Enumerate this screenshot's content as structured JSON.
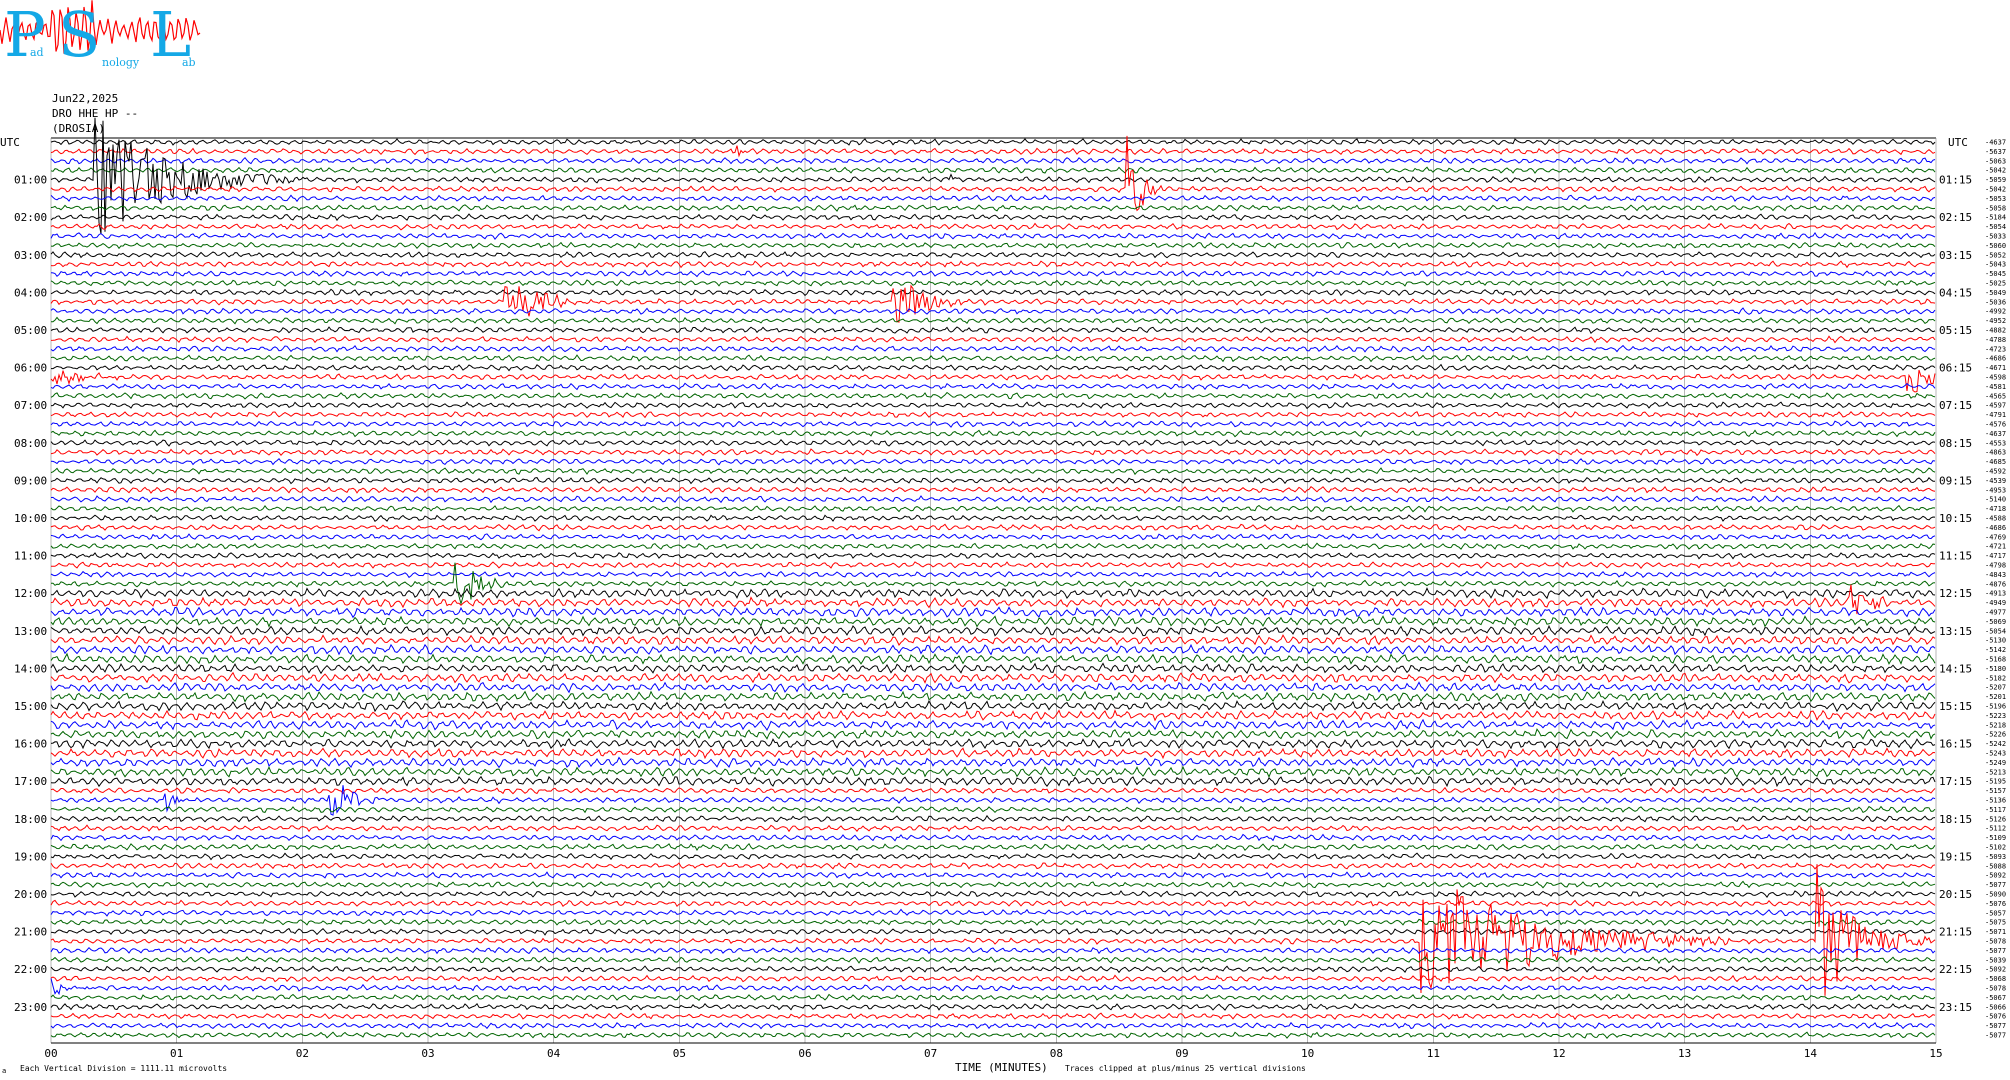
{
  "logo": {
    "letters": [
      "P",
      "S",
      "L"
    ],
    "sub_left": "ad",
    "sub_mid": "nology",
    "sub_right": "ab",
    "color": "#14a8e6",
    "trace_color": "#ff0000"
  },
  "header": {
    "date": "Jun22,2025",
    "station_line": "DRO HHE HP --",
    "station_name": "(DROSIA)"
  },
  "chart_data": {
    "type": "line",
    "chart_kind": "helicorder seismogram",
    "title": "",
    "xlabel": "TIME (MINUTES)",
    "left_axis_title": "UTC",
    "right_axis_title": "UTC",
    "x_range": [
      0,
      15
    ],
    "x_ticks": [
      "00",
      "01",
      "02",
      "03",
      "04",
      "05",
      "06",
      "07",
      "08",
      "09",
      "10",
      "11",
      "12",
      "13",
      "14",
      "15"
    ],
    "rows_count": 96,
    "minutes_per_row": 15,
    "trace_colors": [
      "#000000",
      "#ff0000",
      "#0000ff",
      "#006400"
    ],
    "left_hour_labels": [
      "01:00",
      "02:00",
      "03:00",
      "04:00",
      "05:00",
      "06:00",
      "07:00",
      "08:00",
      "09:00",
      "10:00",
      "11:00",
      "12:00",
      "13:00",
      "14:00",
      "15:00",
      "16:00",
      "17:00",
      "18:00",
      "19:00",
      "20:00",
      "21:00",
      "22:00",
      "23:00"
    ],
    "right_hour_labels": [
      "01:15",
      "02:15",
      "03:15",
      "04:15",
      "05:15",
      "06:15",
      "07:15",
      "08:15",
      "09:15",
      "10:15",
      "11:15",
      "12:15",
      "13:15",
      "14:15",
      "15:15",
      "16:15",
      "17:15",
      "18:15",
      "19:15",
      "20:15",
      "21:15",
      "22:15",
      "23:15"
    ],
    "row_offsets": [
      -4637,
      -5637,
      -5063,
      -5042,
      -5059,
      -5042,
      -5053,
      -5058,
      -5184,
      -5054,
      -5033,
      -5060,
      -5052,
      -5043,
      -5045,
      -5025,
      -5049,
      -5036,
      -4992,
      -4952,
      -4882,
      -4788,
      -4723,
      -4686,
      -4671,
      -4598,
      -4581,
      -4565,
      -4597,
      -4791,
      -4576,
      -4637,
      -4553,
      -4863,
      -4685,
      -4592,
      -4539,
      -4953,
      -5140,
      -4718,
      -4588,
      -4686,
      -4769,
      -4721,
      -4717,
      -4798,
      -4843,
      -4876,
      -4913,
      -4949,
      -4977,
      -5069,
      -5054,
      -5130,
      -5142,
      -5168,
      -5180,
      -5182,
      -5207,
      -5201,
      -5196,
      -5223,
      -5218,
      -5226,
      -5242,
      -5243,
      -5249,
      -5213,
      -5195,
      -5157,
      -5136,
      -5117,
      -5126,
      -5112,
      -5109,
      -5102,
      -5093,
      -5088,
      -5092,
      -5077,
      -5090,
      -5076,
      -5057,
      -5075,
      -5071,
      -5078,
      -5077,
      -5039,
      -5092,
      -5068,
      -5078,
      -5067,
      -5066,
      -5076,
      -5077,
      -5077
    ],
    "events": [
      {
        "row": 1,
        "minute": 5.45,
        "amplitude": 2.5,
        "duration": 0.08,
        "color_row": true
      },
      {
        "row": 4,
        "minute": 7.15,
        "amplitude": 2.5,
        "duration": 0.05,
        "color_row": true
      },
      {
        "row": 4,
        "minute": 0.35,
        "amplitude": 6,
        "duration": 1.7,
        "color_row": true
      },
      {
        "row": 5,
        "minute": 8.55,
        "amplitude": 6,
        "duration": 0.3,
        "color_row": true
      },
      {
        "row": 17,
        "minute": 3.6,
        "amplitude": 3,
        "duration": 0.7,
        "color_row": true
      },
      {
        "row": 17,
        "minute": 6.7,
        "amplitude": 3,
        "duration": 0.6,
        "color_row": true
      },
      {
        "row": 25,
        "minute": 0.0,
        "amplitude": 1.2,
        "duration": 0.6,
        "color_row": true
      },
      {
        "row": 25,
        "minute": 14.75,
        "amplitude": 4,
        "duration": 0.35,
        "color_row": true
      },
      {
        "row": 47,
        "minute": 3.2,
        "amplitude": 3.5,
        "duration": 0.5,
        "color_row": true
      },
      {
        "row": 49,
        "minute": 14.3,
        "amplitude": 3,
        "duration": 0.4,
        "color_row": true
      },
      {
        "row": 70,
        "minute": 2.2,
        "amplitude": 3,
        "duration": 0.5,
        "color_row": true
      },
      {
        "row": 70,
        "minute": 0.9,
        "amplitude": 1.2,
        "duration": 0.3,
        "color_row": true
      },
      {
        "row": 85,
        "minute": 10.9,
        "amplitude": 7,
        "duration": 2.5,
        "color_row": true
      },
      {
        "row": 85,
        "minute": 14.05,
        "amplitude": 7,
        "duration": 0.9,
        "color_row": true
      },
      {
        "row": 90,
        "minute": 0.0,
        "amplitude": 1.0,
        "duration": 0.5,
        "color_row": true
      }
    ]
  },
  "footer": {
    "vertical_division": "Each Vertical Division = 1111.11 microvolts",
    "clip_note": "Traces clipped at plus/minus 25 vertical divisions",
    "corner_mark": "a"
  }
}
